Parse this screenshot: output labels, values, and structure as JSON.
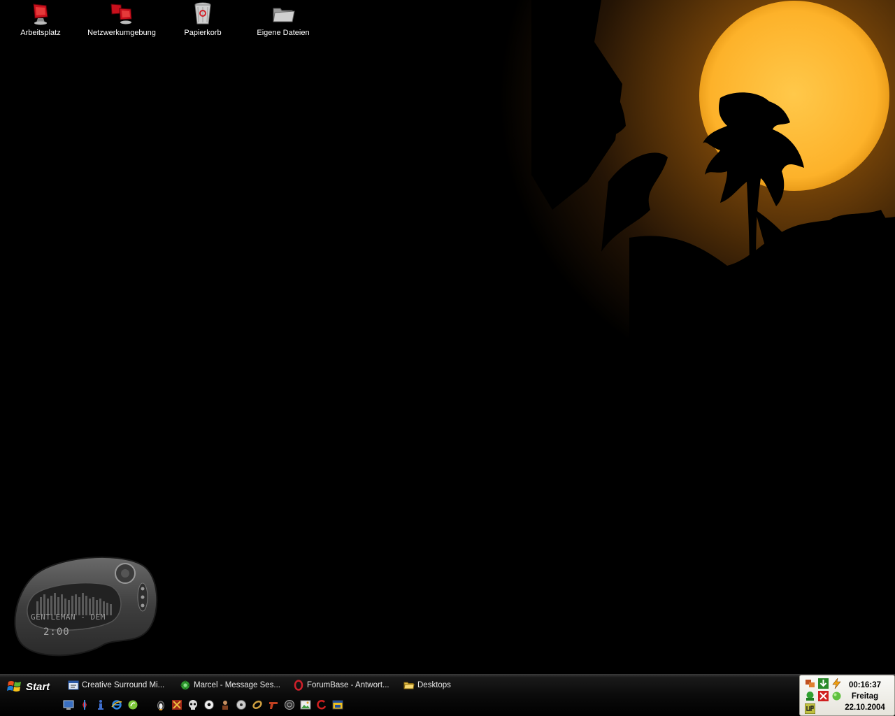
{
  "desktop_icons": [
    {
      "label": "Arbeitsplatz",
      "icon": "computer-icon"
    },
    {
      "label": "Netzwerkumgebung",
      "icon": "network-places-icon"
    },
    {
      "label": "Papierkorb",
      "icon": "recycle-bin-icon"
    },
    {
      "label": "Eigene Dateien",
      "icon": "folder-icon"
    }
  ],
  "media_player": {
    "track": "GENTLEMAN - DEM",
    "time": "2:00"
  },
  "taskbar": {
    "start_label": "Start",
    "tasks": [
      {
        "label": "Creative Surround Mi...",
        "icon": "mixer-window-icon"
      },
      {
        "label": "Marcel - Message Ses...",
        "icon": "messenger-icon"
      },
      {
        "label": "ForumBase - Antwort...",
        "icon": "opera-browser-icon"
      },
      {
        "label": "Desktops",
        "icon": "folder-icon"
      }
    ],
    "quick_launch": [
      "desktop-icon",
      "winamp-icon",
      "info-icon",
      "internet-explorer-icon",
      "browser-icon",
      "penguin-icon",
      "game-icon",
      "skull-icon",
      "soccer-ball-icon",
      "character-icon",
      "disc-icon",
      "ring-icon",
      "gun-icon",
      "media-icon",
      "image-icon",
      "refresh-icon",
      "window-icon"
    ]
  },
  "tray": {
    "icons": [
      "network-icon",
      "download-icon",
      "bolt-icon",
      "messenger-tray-icon",
      "antivirus-icon",
      "green-ball-icon",
      "up-icon"
    ],
    "time": "00:16:37",
    "day": "Freitag",
    "date": "22.10.2004"
  },
  "colors": {
    "sun": "#FDB22A",
    "sun_glow": "#5a3a08",
    "taskbar": "#0b0b0b",
    "tray_bg": "#F2F1EC"
  }
}
